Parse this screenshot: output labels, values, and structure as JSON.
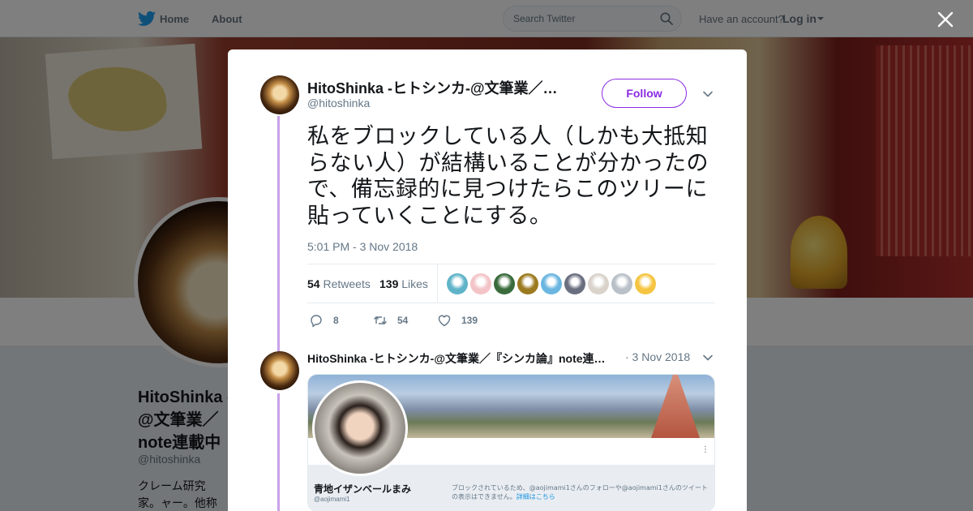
{
  "nav": {
    "home_label": "Home",
    "about_label": "About",
    "search_placeholder": "Search Twitter",
    "account_text": "Have an account?",
    "login_label": "Log in"
  },
  "profile": {
    "name": "HitoShinka -@文筆業／note連載中",
    "handle": "@hitoshinka",
    "bio": "クレーム研究家。ャー。他称ミソジ"
  },
  "tweet": {
    "author_name": "HitoShinka -ヒトシンカ-@文筆業／…",
    "author_handle": "@hitoshinka",
    "follow_label": "Follow",
    "text": "私をブロックしている人（しかも大抵知らない人）が結構いることが分かったので、備忘録的に見つけたらこのツリーに貼っていくことにする。",
    "time": "5:01 PM - 3 Nov 2018",
    "retweets_count": "54",
    "retweets_label": "Retweets",
    "likes_count": "139",
    "likes_label": "Likes",
    "liker_colors": [
      "#5fb3c8",
      "#f3c4c7",
      "#3a6b3c",
      "#9b7a20",
      "#6ab6e0",
      "#6a6f80",
      "#d9d3cb",
      "#b9c0c8",
      "#f5c542"
    ],
    "actions": {
      "reply_count": "8",
      "retweet_count": "54",
      "like_count": "139"
    }
  },
  "reply": {
    "author_name": "HitoShinka -ヒトシンカ-@文筆業／『シンカ論』note連載中",
    "date": "· 3 Nov 2018",
    "embed": {
      "name": "青地イザンベールまみ",
      "handle": "@aojimami1",
      "note": "ブロックされているため、@aojimami1さんのフォローや@aojimami1さんのツイートの表示はできません。",
      "link": "詳細はこちら"
    }
  },
  "colors": {
    "accent": "#8a2be2",
    "thread_line": "#c9a0e8",
    "twitter_blue": "#1da1f2"
  }
}
